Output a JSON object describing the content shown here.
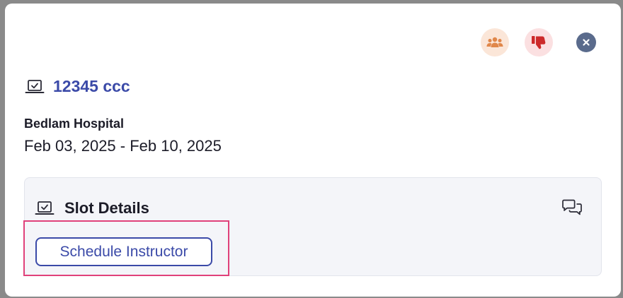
{
  "header": {
    "icons": [
      "group-icon",
      "thumbs-down-icon",
      "close-icon"
    ]
  },
  "item": {
    "title": "12345 ccc",
    "organization": "Bedlam Hospital",
    "date_range": "Feb 03, 2025 - Feb 10, 2025"
  },
  "slot": {
    "title": "Slot Details",
    "schedule_label": "Schedule Instructor"
  },
  "colors": {
    "accent": "#3b4aa8",
    "highlight": "#e0417a",
    "group_bg": "#fbe6d8",
    "group_fg": "#e0874a",
    "thumb_bg": "#fbe0e1",
    "thumb_fg": "#cc2a2a",
    "close_bg": "#5a6b8c"
  }
}
